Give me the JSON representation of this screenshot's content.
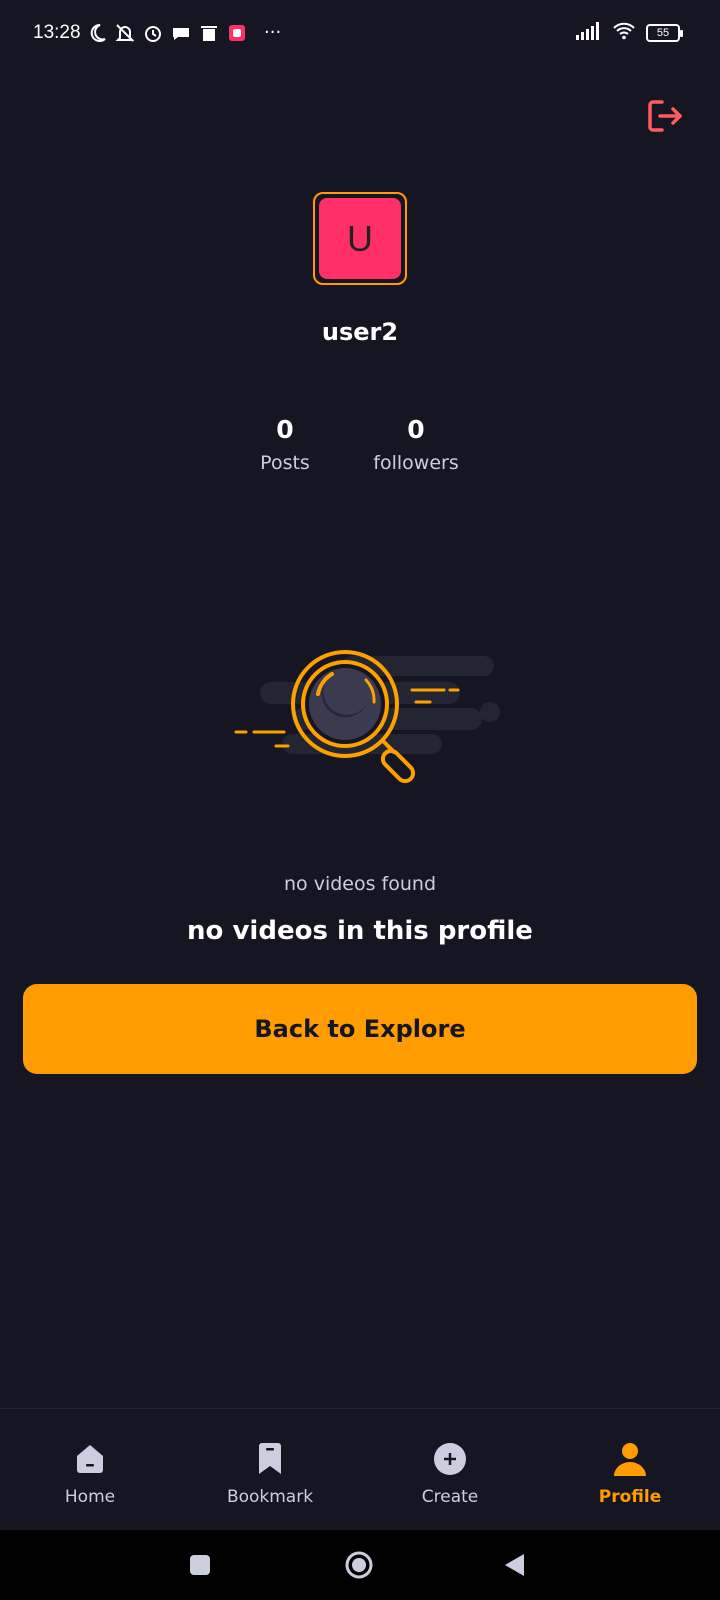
{
  "status_bar": {
    "time": "13:28",
    "battery": "55",
    "overflow": "···"
  },
  "profile": {
    "avatar_initial": "U",
    "username": "user2",
    "stats": [
      {
        "value": "0",
        "label": "Posts"
      },
      {
        "value": "0",
        "label": "followers"
      }
    ]
  },
  "empty_state": {
    "title": "no videos found",
    "subtitle": "no videos in this profile",
    "button_label": "Back to Explore"
  },
  "tabs": [
    {
      "label": "Home",
      "icon": "home-icon",
      "active": false
    },
    {
      "label": "Bookmark",
      "icon": "bookmark-icon",
      "active": false
    },
    {
      "label": "Create",
      "icon": "plus-icon",
      "active": false
    },
    {
      "label": "Profile",
      "icon": "profile-icon",
      "active": true
    }
  ],
  "colors": {
    "background": "#161622",
    "accent": "#ff9c01",
    "avatar_bg": "#ff3067",
    "logout_icon": "#ff5a5f",
    "tab_inactive": "#cdcde0"
  }
}
